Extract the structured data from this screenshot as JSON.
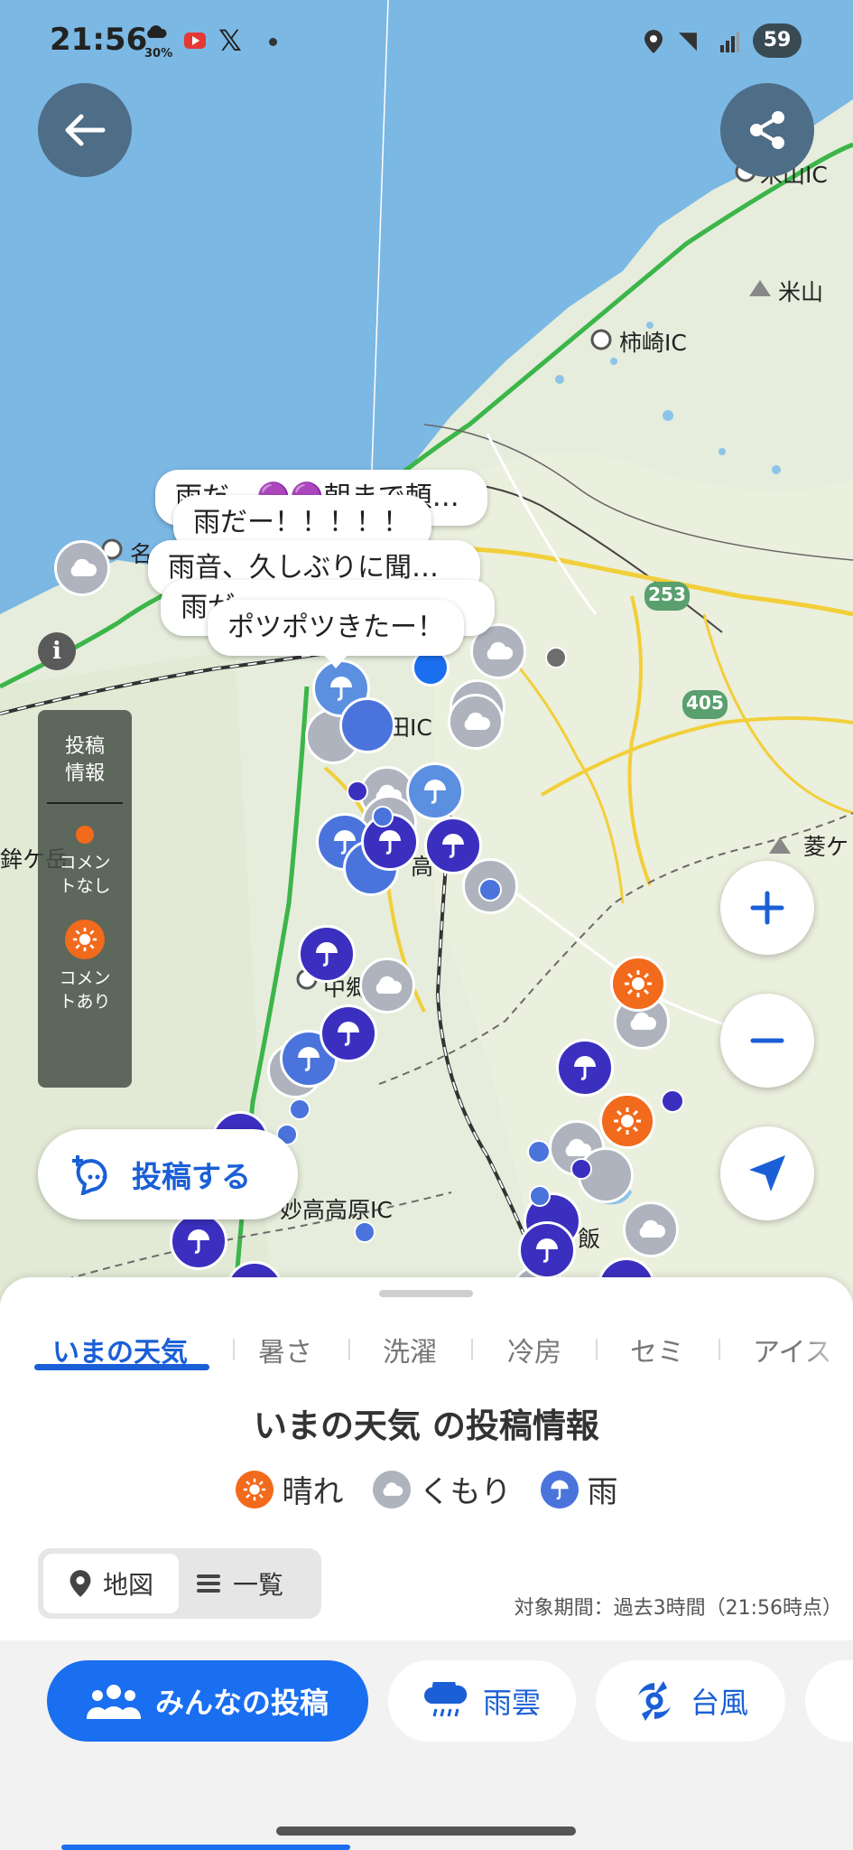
{
  "status_bar": {
    "time": "21:56",
    "weather_pct": "30%",
    "battery": "59",
    "wifi_glyph": "◥"
  },
  "map": {
    "place_labels": {
      "yoneyama_ic": "米山IC",
      "yoneyama": "米山",
      "kakizaki_ic": "柿崎IC",
      "route_253": "253",
      "route_405": "405",
      "takada_ic": "高田IC",
      "hokogatake": "鉾ケ岳",
      "hishigatake": "菱ケ",
      "myoko_kogen_ic": "妙高高原IC",
      "na_fragment": "名",
      "ko_fragment": "高",
      "naka_fragment": "中郷",
      "ii_fragment": "飯"
    },
    "bubbles": [
      "雨だ…🟣🟣朝まで頼…",
      "雨だー！！！！！",
      "雨音、久しぶりに聞…",
      "雨が…",
      "ポツポツきたー！"
    ],
    "info_label": "i",
    "legend": {
      "title": "投稿情報",
      "no_comment": "コメントなし",
      "with_comment": "コメントあり"
    },
    "post_button": "投稿する",
    "colors": {
      "sunny": "#f26a1b",
      "cloudy": "#aeb3bd",
      "rain": "#4a74dc",
      "rain_heavy": "#3b2fbf",
      "accent": "#1a6ef0"
    }
  },
  "sheet": {
    "tabs": [
      "いまの天気",
      "暑さ",
      "洗濯",
      "冷房",
      "セミ",
      "アイス"
    ],
    "active_tab": "いまの天気",
    "title": "いまの天気 の投稿情報",
    "weather_legend": [
      "晴れ",
      "くもり",
      "雨"
    ],
    "view_toggle": {
      "map": "地図",
      "list": "一覧"
    },
    "period": "対象期間：過去3時間（21:56時点）"
  },
  "bottom_nav": {
    "everyone_posts": "みんなの投稿",
    "rain_cloud": "雨雲",
    "typhoon": "台風"
  },
  "icons": [
    "back-arrow-icon",
    "share-icon",
    "plus-icon",
    "minus-icon",
    "navigation-arrow-icon",
    "info-icon",
    "sun-icon",
    "cloud-icon",
    "umbrella-icon",
    "location-pin-icon",
    "list-icon",
    "people-icon",
    "rain-cloud-icon",
    "typhoon-icon",
    "post-comment-icon"
  ]
}
